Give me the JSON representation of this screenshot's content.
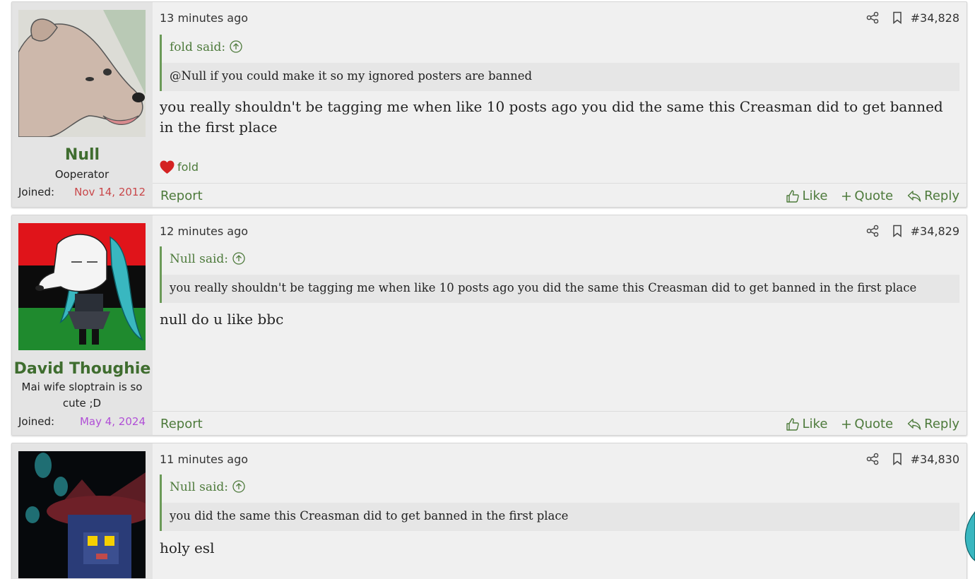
{
  "posts": [
    {
      "user": {
        "name": "Null",
        "title": "Ooperator",
        "joined_label": "Joined:",
        "joined_date": "Nov 14, 2012",
        "joined_color": "#c9474a"
      },
      "time": "13 minutes ago",
      "number": "#34,828",
      "quote": {
        "author": "fold said:",
        "text": "@Null if you could make it so my ignored posters are banned"
      },
      "message": "you really shouldn't be tagging me when like 10 posts ago you did the same this Creasman did to get banned in the first place",
      "reaction": {
        "icon": "heart-icon",
        "user": "fold"
      },
      "footer": {
        "report": "Report",
        "like": "Like",
        "quote": "Quote",
        "reply": "Reply"
      }
    },
    {
      "user": {
        "name": "David Thoughie",
        "title": "Mai wife sloptrain is so cute ;D",
        "joined_label": "Joined:",
        "joined_date": "May 4, 2024",
        "joined_color": "#b04fd6"
      },
      "time": "12 minutes ago",
      "number": "#34,829",
      "quote": {
        "author": "Null said:",
        "text": "you really shouldn't be tagging me when like 10 posts ago you did the same this Creasman did to get banned in the first place"
      },
      "message": "null do u like bbc",
      "footer": {
        "report": "Report",
        "like": "Like",
        "quote": "Quote",
        "reply": "Reply"
      }
    },
    {
      "time": "11 minutes ago",
      "number": "#34,830",
      "quote": {
        "author": "Null said:",
        "text": "you did the same this Creasman did to get banned in the first place"
      },
      "message": "holy esl"
    }
  ],
  "colors": {
    "link_green": "#4d7a3b",
    "username_green": "#3f6d2f",
    "quote_border": "#6b9a58"
  }
}
